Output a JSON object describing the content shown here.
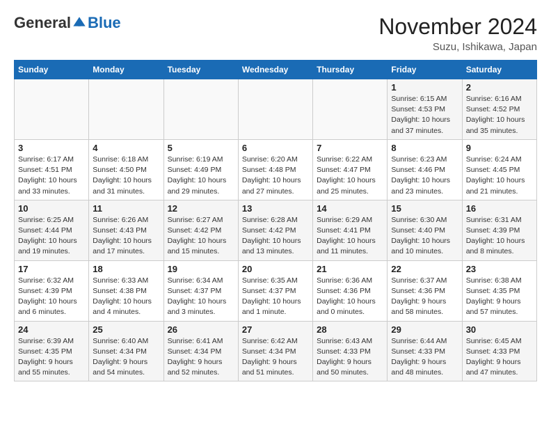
{
  "logo": {
    "general": "General",
    "blue": "Blue"
  },
  "title": "November 2024",
  "location": "Suzu, Ishikawa, Japan",
  "headers": [
    "Sunday",
    "Monday",
    "Tuesday",
    "Wednesday",
    "Thursday",
    "Friday",
    "Saturday"
  ],
  "weeks": [
    [
      {
        "day": "",
        "detail": ""
      },
      {
        "day": "",
        "detail": ""
      },
      {
        "day": "",
        "detail": ""
      },
      {
        "day": "",
        "detail": ""
      },
      {
        "day": "",
        "detail": ""
      },
      {
        "day": "1",
        "detail": "Sunrise: 6:15 AM\nSunset: 4:53 PM\nDaylight: 10 hours and 37 minutes."
      },
      {
        "day": "2",
        "detail": "Sunrise: 6:16 AM\nSunset: 4:52 PM\nDaylight: 10 hours and 35 minutes."
      }
    ],
    [
      {
        "day": "3",
        "detail": "Sunrise: 6:17 AM\nSunset: 4:51 PM\nDaylight: 10 hours and 33 minutes."
      },
      {
        "day": "4",
        "detail": "Sunrise: 6:18 AM\nSunset: 4:50 PM\nDaylight: 10 hours and 31 minutes."
      },
      {
        "day": "5",
        "detail": "Sunrise: 6:19 AM\nSunset: 4:49 PM\nDaylight: 10 hours and 29 minutes."
      },
      {
        "day": "6",
        "detail": "Sunrise: 6:20 AM\nSunset: 4:48 PM\nDaylight: 10 hours and 27 minutes."
      },
      {
        "day": "7",
        "detail": "Sunrise: 6:22 AM\nSunset: 4:47 PM\nDaylight: 10 hours and 25 minutes."
      },
      {
        "day": "8",
        "detail": "Sunrise: 6:23 AM\nSunset: 4:46 PM\nDaylight: 10 hours and 23 minutes."
      },
      {
        "day": "9",
        "detail": "Sunrise: 6:24 AM\nSunset: 4:45 PM\nDaylight: 10 hours and 21 minutes."
      }
    ],
    [
      {
        "day": "10",
        "detail": "Sunrise: 6:25 AM\nSunset: 4:44 PM\nDaylight: 10 hours and 19 minutes."
      },
      {
        "day": "11",
        "detail": "Sunrise: 6:26 AM\nSunset: 4:43 PM\nDaylight: 10 hours and 17 minutes."
      },
      {
        "day": "12",
        "detail": "Sunrise: 6:27 AM\nSunset: 4:42 PM\nDaylight: 10 hours and 15 minutes."
      },
      {
        "day": "13",
        "detail": "Sunrise: 6:28 AM\nSunset: 4:42 PM\nDaylight: 10 hours and 13 minutes."
      },
      {
        "day": "14",
        "detail": "Sunrise: 6:29 AM\nSunset: 4:41 PM\nDaylight: 10 hours and 11 minutes."
      },
      {
        "day": "15",
        "detail": "Sunrise: 6:30 AM\nSunset: 4:40 PM\nDaylight: 10 hours and 10 minutes."
      },
      {
        "day": "16",
        "detail": "Sunrise: 6:31 AM\nSunset: 4:39 PM\nDaylight: 10 hours and 8 minutes."
      }
    ],
    [
      {
        "day": "17",
        "detail": "Sunrise: 6:32 AM\nSunset: 4:39 PM\nDaylight: 10 hours and 6 minutes."
      },
      {
        "day": "18",
        "detail": "Sunrise: 6:33 AM\nSunset: 4:38 PM\nDaylight: 10 hours and 4 minutes."
      },
      {
        "day": "19",
        "detail": "Sunrise: 6:34 AM\nSunset: 4:37 PM\nDaylight: 10 hours and 3 minutes."
      },
      {
        "day": "20",
        "detail": "Sunrise: 6:35 AM\nSunset: 4:37 PM\nDaylight: 10 hours and 1 minute."
      },
      {
        "day": "21",
        "detail": "Sunrise: 6:36 AM\nSunset: 4:36 PM\nDaylight: 10 hours and 0 minutes."
      },
      {
        "day": "22",
        "detail": "Sunrise: 6:37 AM\nSunset: 4:36 PM\nDaylight: 9 hours and 58 minutes."
      },
      {
        "day": "23",
        "detail": "Sunrise: 6:38 AM\nSunset: 4:35 PM\nDaylight: 9 hours and 57 minutes."
      }
    ],
    [
      {
        "day": "24",
        "detail": "Sunrise: 6:39 AM\nSunset: 4:35 PM\nDaylight: 9 hours and 55 minutes."
      },
      {
        "day": "25",
        "detail": "Sunrise: 6:40 AM\nSunset: 4:34 PM\nDaylight: 9 hours and 54 minutes."
      },
      {
        "day": "26",
        "detail": "Sunrise: 6:41 AM\nSunset: 4:34 PM\nDaylight: 9 hours and 52 minutes."
      },
      {
        "day": "27",
        "detail": "Sunrise: 6:42 AM\nSunset: 4:34 PM\nDaylight: 9 hours and 51 minutes."
      },
      {
        "day": "28",
        "detail": "Sunrise: 6:43 AM\nSunset: 4:33 PM\nDaylight: 9 hours and 50 minutes."
      },
      {
        "day": "29",
        "detail": "Sunrise: 6:44 AM\nSunset: 4:33 PM\nDaylight: 9 hours and 48 minutes."
      },
      {
        "day": "30",
        "detail": "Sunrise: 6:45 AM\nSunset: 4:33 PM\nDaylight: 9 hours and 47 minutes."
      }
    ]
  ]
}
